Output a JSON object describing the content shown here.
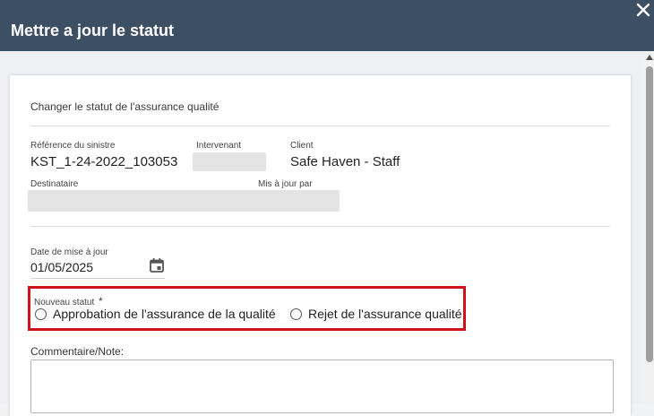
{
  "dialog": {
    "title": "Mettre a jour le statut",
    "close_icon": "close-icon"
  },
  "form": {
    "section_title": "Changer le statut de l'assurance qualité",
    "claim_ref_label": "Référence du sinistre",
    "claim_ref_value": "KST_1-24-2022_103053",
    "intervenant_label": "Intervenant",
    "client_label": "Client",
    "client_value": "Safe Haven - Staff",
    "destinataire_label": "Destinataire",
    "updated_by_label": "Mis à jour par",
    "date_label": "Date de mise à jour",
    "date_value": "01/05/2025",
    "calendar_icon": "calendar-icon",
    "status_label": "Nouveau statut",
    "required_marker": "*",
    "status_options": [
      "Approbation de l'assurance de la qualité",
      "Rejet de l'assurance qualité"
    ],
    "comment_label": "Commentaire/Note:"
  },
  "colors": {
    "header_bg": "#3d4f63",
    "highlight_border": "#d0121c"
  }
}
